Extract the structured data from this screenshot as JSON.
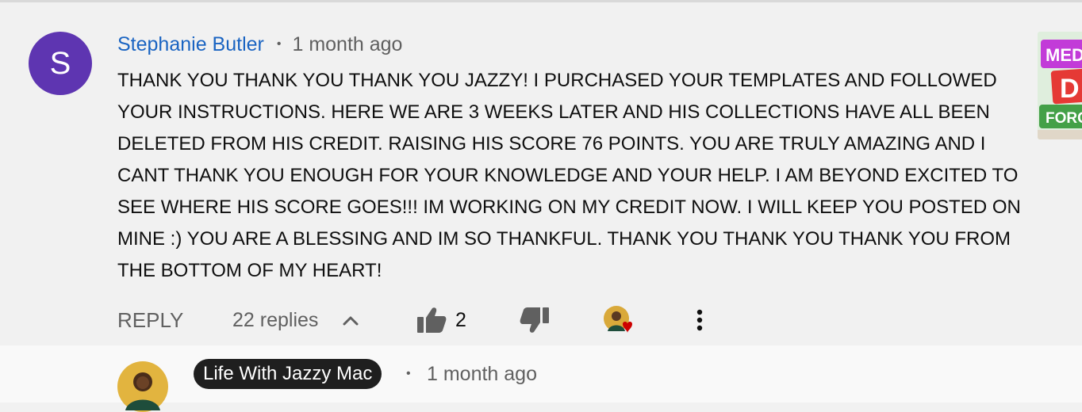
{
  "comment": {
    "avatar_letter": "S",
    "author": "Stephanie Butler",
    "separator": "•",
    "time": "1 month ago",
    "text": "THANK YOU THANK YOU THANK YOU JAZZY! I PURCHASED YOUR TEMPLATES AND FOLLOWED YOUR INSTRUCTIONS. HERE WE ARE 3 WEEKS LATER AND HIS COLLECTIONS HAVE ALL BEEN DELETED FROM HIS CREDIT. RAISING HIS SCORE 76 POINTS. YOU ARE TRULY AMAZING AND I CANT THANK YOU ENOUGH FOR YOUR KNOWLEDGE AND YOUR HELP. I AM BEYOND EXCITED TO SEE WHERE HIS SCORE GOES!!! IM WORKING ON MY CREDIT NOW. I WILL KEEP YOU POSTED ON MINE :) YOU ARE A BLESSING AND IM SO THANKFUL. THANK YOU THANK YOU THANK YOU FROM THE BOTTOM OF MY HEART!",
    "avatar_color": "#5e35b1",
    "author_color": "#1a64c2"
  },
  "thumbnail": {
    "line1": "MED",
    "line2": "D",
    "line3": "FORC"
  },
  "actions": {
    "reply_label": "REPLY",
    "replies_label": "22 replies",
    "like_count": "2",
    "icons": [
      "thumbs-up-icon",
      "thumbs-down-icon",
      "creator-heart-icon",
      "more-vert-icon",
      "chevron-up-icon"
    ]
  },
  "reply": {
    "author": "Life With Jazzy Mac",
    "separator": "•",
    "time": "1 month ago",
    "author_badge_color": "#1f1f1f"
  }
}
